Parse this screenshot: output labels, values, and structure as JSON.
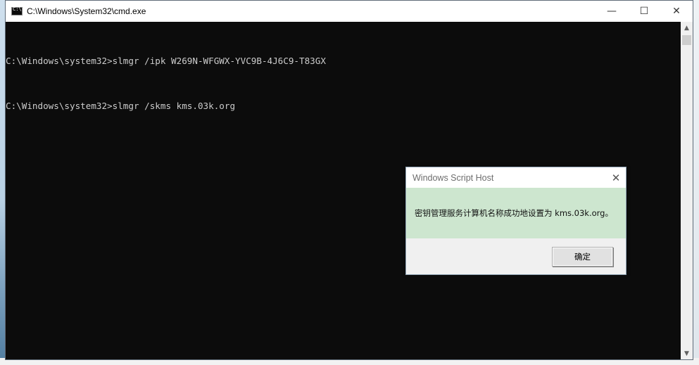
{
  "window": {
    "title": "C:\\Windows\\System32\\cmd.exe",
    "minimize_glyph": "—",
    "maximize_glyph": "☐",
    "close_glyph": "✕"
  },
  "console": {
    "lines": [
      "C:\\Windows\\system32>slmgr /ipk W269N-WFGWX-YVC9B-4J6C9-T83GX",
      "C:\\Windows\\system32>slmgr /skms kms.03k.org"
    ]
  },
  "dialog": {
    "title": "Windows Script Host",
    "message": "密钥管理服务计算机名称成功地设置为 kms.03k.org。",
    "ok_label": "确定",
    "close_glyph": "✕"
  },
  "icons": {
    "app": "terminal-icon",
    "scroll_up": "chevron-up-icon",
    "scroll_down": "chevron-down-icon"
  }
}
